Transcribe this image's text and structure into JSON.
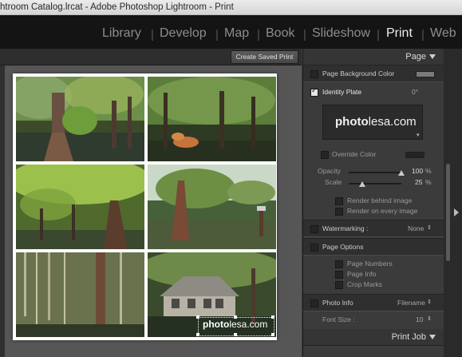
{
  "window": {
    "title": "htroom Catalog.lrcat - Adobe Photoshop Lightroom - Print"
  },
  "modules": {
    "items": [
      "Library",
      "Develop",
      "Map",
      "Book",
      "Slideshow",
      "Print",
      "Web"
    ],
    "active": "Print",
    "separator": "|"
  },
  "toolbar": {
    "create_saved_print": "Create Saved Print"
  },
  "photos": [
    "Cypress trees with moss, left",
    "Cypress grove with autumn shrub",
    "Green canopy over water",
    "Trees reflecting in lake",
    "Hanging moss forest",
    "Boathouse among cypress"
  ],
  "watermark": {
    "bold": "photo",
    "light": "lesa.com"
  },
  "panel": {
    "page": {
      "header": "Page",
      "page_background_color": "Page Background Color",
      "identity_plate": "Identity Plate",
      "identity_angle": "0°",
      "plate_bold": "photo",
      "plate_light": "lesa.com",
      "override_color": "Override Color",
      "opacity_label": "Opacity",
      "opacity_value": "100",
      "opacity_unit": "%",
      "scale_label": "Scale",
      "scale_value": "25",
      "scale_unit": "%",
      "render_behind": "Render behind image",
      "render_every": "Render on every image",
      "watermarking_label": "Watermarking :",
      "watermarking_value": "None",
      "page_options": "Page Options",
      "page_numbers": "Page Numbers",
      "page_info": "Page Info",
      "crop_marks": "Crop Marks",
      "photo_info": "Photo Info",
      "photo_info_value": "Filename",
      "font_size_label": "Font Size :",
      "font_size_value": "10",
      "opacity_fraction": 1.0,
      "scale_fraction": 0.25
    },
    "print_job": {
      "header": "Print Job"
    }
  },
  "colors": {
    "background": "#3d3d3d",
    "panel": "#3b3b3b",
    "active_module": "#ededed"
  }
}
